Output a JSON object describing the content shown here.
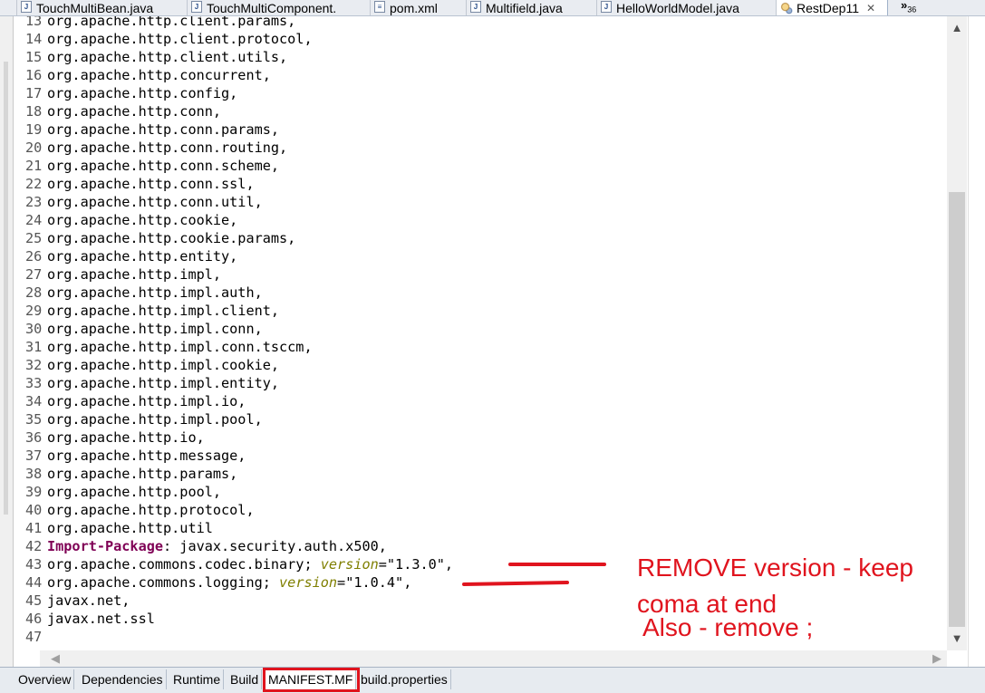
{
  "editor_tabs": [
    {
      "label": "TouchMultiBean.java",
      "icon": "java-file-icon"
    },
    {
      "label": "TouchMultiComponent.",
      "icon": "java-file-icon"
    },
    {
      "label": "pom.xml",
      "icon": "xml-file-icon"
    },
    {
      "label": "Multifield.java",
      "icon": "java-file-icon"
    },
    {
      "label": "HelloWorldModel.java",
      "icon": "java-file-icon"
    },
    {
      "label": "RestDep11",
      "icon": "manifest-icon",
      "active": true,
      "close": "✕"
    }
  ],
  "tab_overflow": {
    "symbol": "»",
    "count": "36"
  },
  "code_lines": [
    {
      "num": "13",
      "text": "org.apache.http.client.params,"
    },
    {
      "num": "14",
      "text": "org.apache.http.client.protocol,"
    },
    {
      "num": "15",
      "text": "org.apache.http.client.utils,"
    },
    {
      "num": "16",
      "text": "org.apache.http.concurrent,"
    },
    {
      "num": "17",
      "text": "org.apache.http.config,"
    },
    {
      "num": "18",
      "text": "org.apache.http.conn,"
    },
    {
      "num": "19",
      "text": "org.apache.http.conn.params,"
    },
    {
      "num": "20",
      "text": "org.apache.http.conn.routing,"
    },
    {
      "num": "21",
      "text": "org.apache.http.conn.scheme,"
    },
    {
      "num": "22",
      "text": "org.apache.http.conn.ssl,"
    },
    {
      "num": "23",
      "text": "org.apache.http.conn.util,"
    },
    {
      "num": "24",
      "text": "org.apache.http.cookie,"
    },
    {
      "num": "25",
      "text": "org.apache.http.cookie.params,"
    },
    {
      "num": "26",
      "text": "org.apache.http.entity,"
    },
    {
      "num": "27",
      "text": "org.apache.http.impl,"
    },
    {
      "num": "28",
      "text": "org.apache.http.impl.auth,"
    },
    {
      "num": "29",
      "text": "org.apache.http.impl.client,"
    },
    {
      "num": "30",
      "text": "org.apache.http.impl.conn,"
    },
    {
      "num": "31",
      "text": "org.apache.http.impl.conn.tsccm,"
    },
    {
      "num": "32",
      "text": "org.apache.http.impl.cookie,"
    },
    {
      "num": "33",
      "text": "org.apache.http.impl.entity,"
    },
    {
      "num": "34",
      "text": "org.apache.http.impl.io,"
    },
    {
      "num": "35",
      "text": "org.apache.http.impl.pool,"
    },
    {
      "num": "36",
      "text": "org.apache.http.io,"
    },
    {
      "num": "37",
      "text": "org.apache.http.message,"
    },
    {
      "num": "38",
      "text": "org.apache.http.params,"
    },
    {
      "num": "39",
      "text": "org.apache.http.pool,"
    },
    {
      "num": "40",
      "text": "org.apache.http.protocol,"
    },
    {
      "num": "41",
      "text": "org.apache.http.util"
    },
    {
      "num": "42",
      "keyword": "Import-Package",
      "text": ": javax.security.auth.x500,"
    },
    {
      "num": "43",
      "text": "org.apache.commons.codec.binary; ",
      "attr": "version",
      "rest": "=\"1.3.0\","
    },
    {
      "num": "44",
      "text": "org.apache.commons.logging; ",
      "attr": "version",
      "rest": "=\"1.0.4\","
    },
    {
      "num": "45",
      "text": "javax.net,"
    },
    {
      "num": "46",
      "text": "javax.net.ssl"
    },
    {
      "num": "47",
      "text": ""
    }
  ],
  "page_tabs": [
    {
      "label": "Overview"
    },
    {
      "label": "Dependencies"
    },
    {
      "label": "Runtime"
    },
    {
      "label": "Build"
    },
    {
      "label": "MANIFEST.MF",
      "active": true
    },
    {
      "label": "build.properties"
    }
  ],
  "annotations": {
    "line1": "REMOVE version - keep",
    "line2": "coma at end",
    "line3": "Also - remove ;",
    "color": "#e0141e"
  },
  "scroll_icons": {
    "up": "▲",
    "down": "▼",
    "left": "◀",
    "right": "▶"
  }
}
